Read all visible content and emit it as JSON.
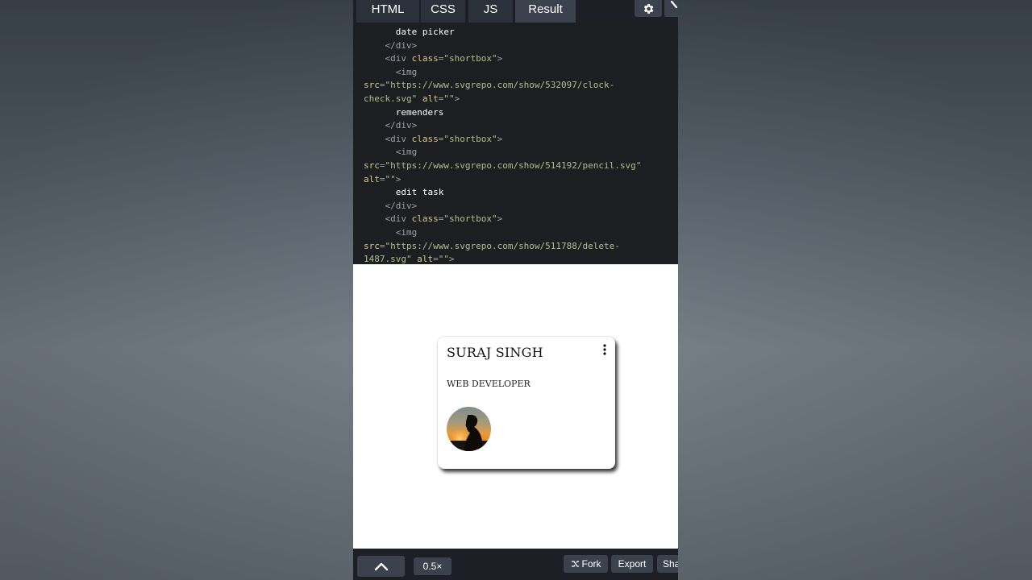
{
  "tabs": [
    {
      "label": "HTML",
      "active": false
    },
    {
      "label": "CSS",
      "active": false
    },
    {
      "label": "JS",
      "active": false
    },
    {
      "label": "Result",
      "active": true
    }
  ],
  "toolbar": {
    "settings_icon": "gear-icon",
    "expand_icon": "expand-icon"
  },
  "code_lines": [
    {
      "indent": 6,
      "parts": [
        {
          "t": "txt",
          "v": "date picker"
        }
      ]
    },
    {
      "indent": 4,
      "parts": [
        {
          "t": "tag",
          "v": "</div>"
        }
      ]
    },
    {
      "indent": 4,
      "parts": [
        {
          "t": "tag",
          "v": "<div "
        },
        {
          "t": "attr",
          "v": "class"
        },
        {
          "t": "tag",
          "v": "="
        },
        {
          "t": "str",
          "v": "\"shortbox\""
        },
        {
          "t": "tag",
          "v": ">"
        }
      ]
    },
    {
      "indent": 6,
      "parts": [
        {
          "t": "tag",
          "v": "<img"
        }
      ]
    },
    {
      "indent": 0,
      "parts": [
        {
          "t": "attr",
          "v": "src"
        },
        {
          "t": "tag",
          "v": "="
        },
        {
          "t": "str",
          "v": "\"https://www.svgrepo.com/show/532097/clock-"
        }
      ]
    },
    {
      "indent": 0,
      "parts": [
        {
          "t": "str",
          "v": "check.svg\" "
        },
        {
          "t": "attr",
          "v": "alt"
        },
        {
          "t": "tag",
          "v": "="
        },
        {
          "t": "str",
          "v": "\"\""
        },
        {
          "t": "tag",
          "v": ">"
        }
      ]
    },
    {
      "indent": 6,
      "parts": [
        {
          "t": "txt",
          "v": "remenders"
        }
      ]
    },
    {
      "indent": 4,
      "parts": [
        {
          "t": "tag",
          "v": "</div>"
        }
      ]
    },
    {
      "indent": 4,
      "parts": [
        {
          "t": "tag",
          "v": "<div "
        },
        {
          "t": "attr",
          "v": "class"
        },
        {
          "t": "tag",
          "v": "="
        },
        {
          "t": "str",
          "v": "\"shortbox\""
        },
        {
          "t": "tag",
          "v": ">"
        }
      ]
    },
    {
      "indent": 6,
      "parts": [
        {
          "t": "tag",
          "v": "<img"
        }
      ]
    },
    {
      "indent": 0,
      "parts": [
        {
          "t": "attr",
          "v": "src"
        },
        {
          "t": "tag",
          "v": "="
        },
        {
          "t": "str",
          "v": "\"https://www.svgrepo.com/show/514192/pencil.svg\""
        }
      ]
    },
    {
      "indent": 0,
      "parts": [
        {
          "t": "attr",
          "v": "alt"
        },
        {
          "t": "tag",
          "v": "="
        },
        {
          "t": "str",
          "v": "\"\""
        },
        {
          "t": "tag",
          "v": ">"
        }
      ]
    },
    {
      "indent": 6,
      "parts": [
        {
          "t": "txt",
          "v": "edit task"
        }
      ]
    },
    {
      "indent": 4,
      "parts": [
        {
          "t": "tag",
          "v": "</div>"
        }
      ]
    },
    {
      "indent": 4,
      "parts": [
        {
          "t": "tag",
          "v": "<div "
        },
        {
          "t": "attr",
          "v": "class"
        },
        {
          "t": "tag",
          "v": "="
        },
        {
          "t": "str",
          "v": "\"shortbox\""
        },
        {
          "t": "tag",
          "v": ">"
        }
      ]
    },
    {
      "indent": 6,
      "parts": [
        {
          "t": "tag",
          "v": "<img"
        }
      ]
    },
    {
      "indent": 0,
      "parts": [
        {
          "t": "attr",
          "v": "src"
        },
        {
          "t": "tag",
          "v": "="
        },
        {
          "t": "str",
          "v": "\"https://www.svgrepo.com/show/511788/delete-"
        }
      ]
    },
    {
      "indent": 0,
      "parts": [
        {
          "t": "str",
          "v": "1487.svg\" "
        },
        {
          "t": "attr",
          "v": "alt"
        },
        {
          "t": "tag",
          "v": "="
        },
        {
          "t": "str",
          "v": "\"\""
        },
        {
          "t": "tag",
          "v": ">"
        }
      ]
    }
  ],
  "card": {
    "name": "SURAJ SINGH",
    "role": "WEB DEVELOPER",
    "menu_icon": "more-vertical-icon",
    "avatar_icon": "avatar-silhouette"
  },
  "bottom": {
    "up_icon": "chevron-up-icon",
    "zoom": "0.5×",
    "fork_label": "Fork",
    "fork_icon": "fork-icon",
    "export_label": "Export",
    "share_label": "Sha"
  },
  "colors": {
    "editor_bg": "#1d1e22",
    "tab_bg": "#2c303a",
    "tab_active_bg": "#3b414d",
    "code_tag": "#9aa0a6",
    "code_attr": "#d6c58c",
    "code_string": "#a9c08a"
  }
}
